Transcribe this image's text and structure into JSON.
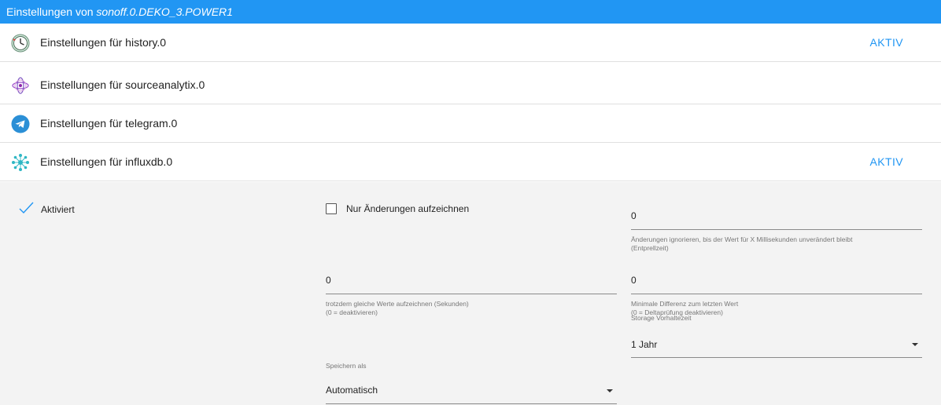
{
  "titlebar": {
    "prefix": "Einstellungen von ",
    "object_id": "sonoff.0.DEKO_3.POWER1"
  },
  "adapters": [
    {
      "icon": "history-clock-icon",
      "label": "Einstellungen für history.0",
      "status": "AKTIV"
    },
    {
      "icon": "sourceanalytix-icon",
      "label": "Einstellungen für sourceanalytix.0",
      "status": ""
    },
    {
      "icon": "telegram-icon",
      "label": "Einstellungen für telegram.0",
      "status": ""
    },
    {
      "icon": "influxdb-icon",
      "label": "Einstellungen für influxdb.0",
      "status": "AKTIV"
    }
  ],
  "influx_settings": {
    "enabled_label": "Aktiviert",
    "only_changes_label": "Nur Änderungen aufzeichnen",
    "debounce": {
      "value": "0",
      "helper_line1": "Änderungen ignorieren, bis der Wert für X Millisekunden unverändert bleibt",
      "helper_line2": "(Entprellzeit)"
    },
    "same_values": {
      "value": "0",
      "helper_line1": "trotzdem gleiche Werte aufzeichnen (Sekunden)",
      "helper_line2": "(0 = deaktivieren)"
    },
    "min_diff": {
      "value": "0",
      "helper_line1": "Minimale Differenz zum letzten Wert",
      "helper_line2": "(0 = Deltaprüfung deaktivieren)"
    },
    "retention": {
      "caption": "Storage Vorhaltezeit",
      "value": "1 Jahr"
    },
    "store_as": {
      "caption": "Speichern als",
      "value": "Automatisch"
    }
  },
  "colors": {
    "accent": "#2196f3",
    "panel_bg": "#f3f3f3"
  }
}
